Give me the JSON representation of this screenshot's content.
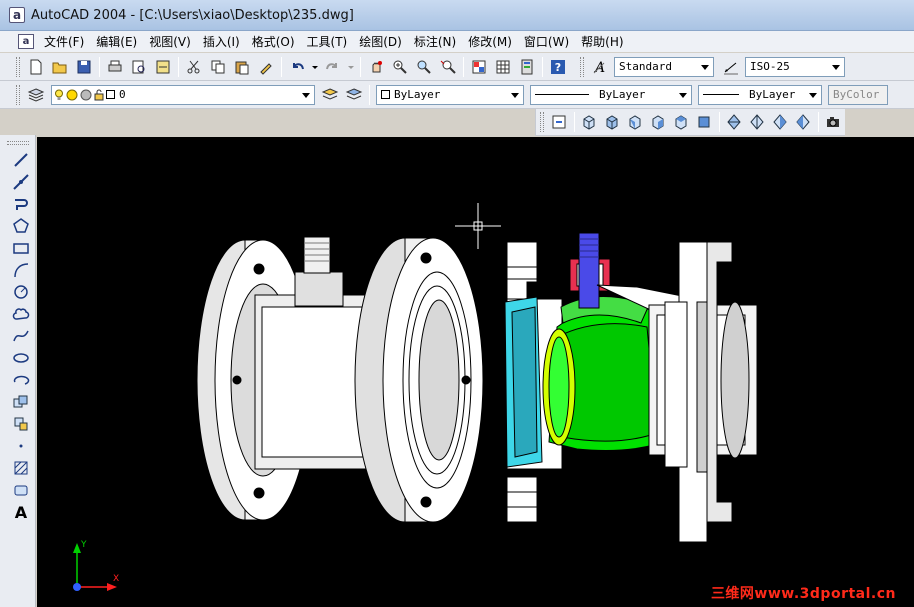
{
  "window": {
    "app_icon": "a",
    "title": "AutoCAD 2004 - [C:\\Users\\xiao\\Desktop\\235.dwg]"
  },
  "menubar": {
    "doc_icon": "a",
    "items": [
      "文件(F)",
      "编辑(E)",
      "视图(V)",
      "插入(I)",
      "格式(O)",
      "工具(T)",
      "绘图(D)",
      "标注(N)",
      "修改(M)",
      "窗口(W)",
      "帮助(H)"
    ]
  },
  "standard_toolbar": {
    "text_style": "Standard",
    "dim_style": "ISO-25"
  },
  "layers_toolbar": {
    "current_layer": "0"
  },
  "properties_toolbar": {
    "color": "ByLayer",
    "linetype": "ByLayer",
    "lineweight": "ByLayer",
    "plotstyle": "ByColor"
  },
  "left_toolbar": {
    "text_tool_label": "A"
  },
  "canvas": {
    "ucs_y_label": "Y",
    "ucs_x_label": "X",
    "watermark": "三维网www.3dportal.cn"
  },
  "colors": {
    "canvas_bg": "#000000",
    "model_white": "#ffffff",
    "model_gray": "#d8d8d8",
    "ball_green": "#00e000",
    "seat_cyan": "#3ed6e8",
    "stem_blue": "#4a4ae8",
    "gland_red": "#e83050",
    "watermark": "#ff2a1a"
  }
}
